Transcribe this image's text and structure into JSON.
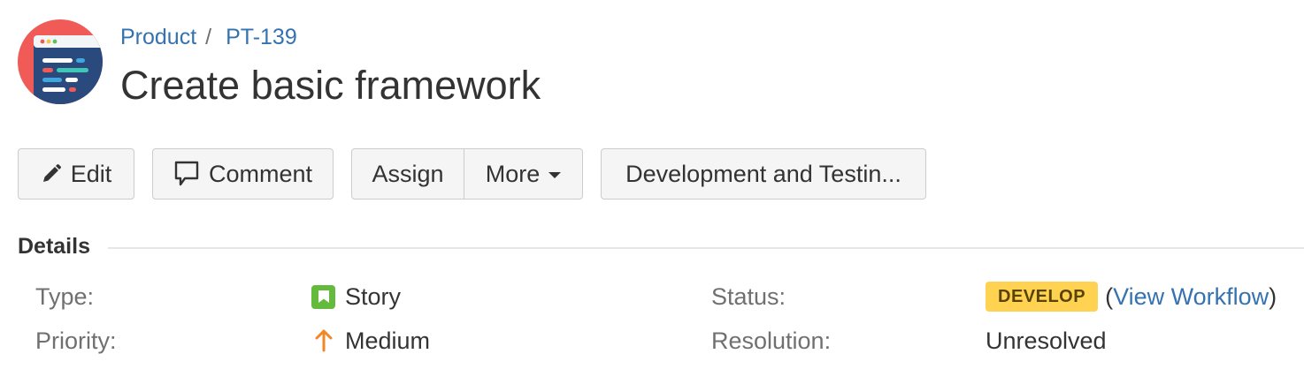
{
  "project": {
    "avatar_icon": "project-avatar-icon"
  },
  "breadcrumb": {
    "project": "Product",
    "separator": "/",
    "issue_key": "PT-139"
  },
  "issue": {
    "title": "Create basic framework"
  },
  "toolbar": {
    "edit_label": "Edit",
    "edit_icon": "pencil-icon",
    "comment_label": "Comment",
    "comment_icon": "speech-bubble-icon",
    "assign_label": "Assign",
    "more_label": "More",
    "workflow_label": "Development and Testin..."
  },
  "details": {
    "heading": "Details",
    "type_label": "Type:",
    "type_value": "Story",
    "type_icon": "story-icon",
    "type_color": "#63ba3c",
    "priority_label": "Priority:",
    "priority_value": "Medium",
    "priority_icon": "arrow-up-icon",
    "priority_color": "#f08826",
    "status_label": "Status:",
    "status_value": "DEVELOP",
    "status_color": "#ffd351",
    "view_workflow_open": "(",
    "view_workflow_link": "View Workflow",
    "view_workflow_close": ")",
    "resolution_label": "Resolution:",
    "resolution_value": "Unresolved"
  },
  "colors": {
    "link": "#3572b0",
    "text": "#333333",
    "label": "#707070"
  }
}
